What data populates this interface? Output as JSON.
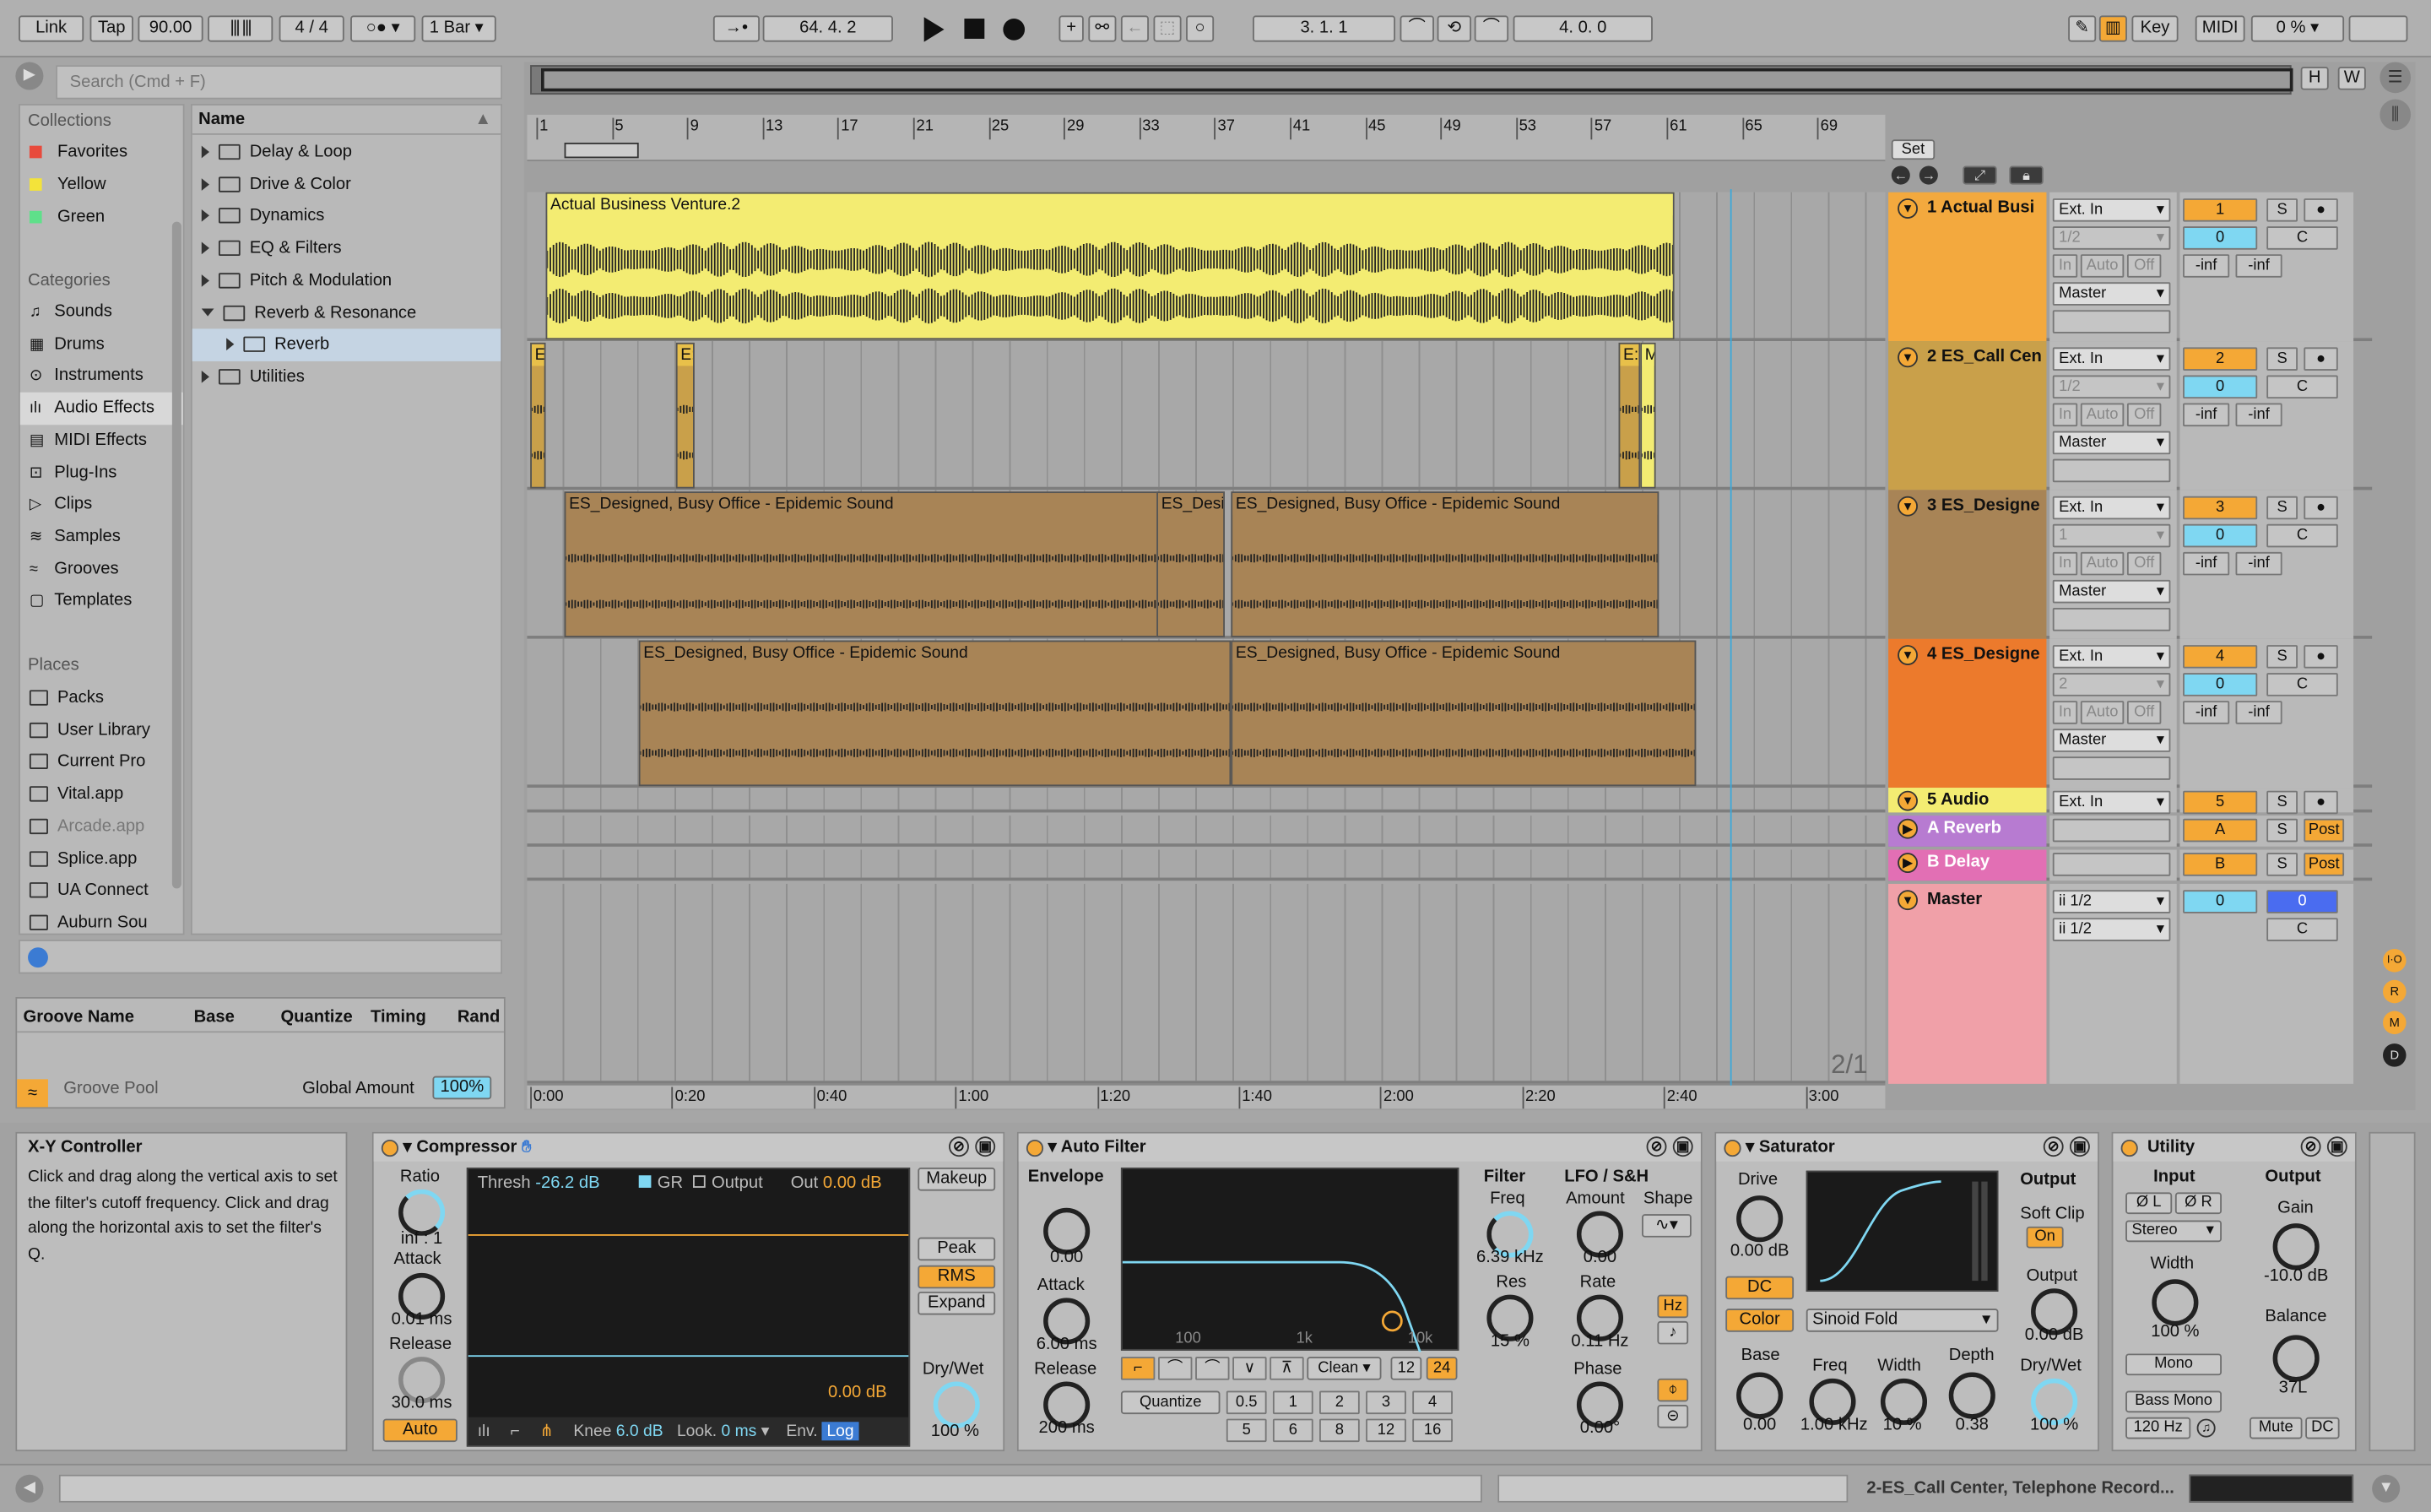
{
  "transport": {
    "link": "Link",
    "tap": "Tap",
    "tempo": "90.00",
    "meter": "4 / 4",
    "quant": "1 Bar",
    "position": "64.   4.   2",
    "loop_start": "3.   1.   1",
    "loop_len": "4.   0.   0",
    "key": "Key",
    "midi": "MIDI",
    "cpu": "0 %"
  },
  "browser": {
    "search_placeholder": "Search (Cmd + F)",
    "collections_title": "Collections",
    "collections": [
      {
        "label": "Favorites",
        "color": "#e84a3c"
      },
      {
        "label": "Yellow",
        "color": "#f3e33a"
      },
      {
        "label": "Green",
        "color": "#5fe08a"
      }
    ],
    "categories_title": "Categories",
    "categories": [
      "Sounds",
      "Drums",
      "Instruments",
      "Audio Effects",
      "MIDI Effects",
      "Plug-Ins",
      "Clips",
      "Samples",
      "Grooves",
      "Templates"
    ],
    "places_title": "Places",
    "places": [
      "Packs",
      "User Library",
      "Current Pro",
      "Vital.app",
      "Arcade.app",
      "Splice.app",
      "UA Connect",
      "Auburn Sou"
    ],
    "name_header": "Name",
    "items": [
      "Delay & Loop",
      "Drive & Color",
      "Dynamics",
      "EQ & Filters",
      "Pitch & Modulation",
      "Reverb & Resonance",
      "Reverb",
      "Utilities"
    ]
  },
  "groove": {
    "headers": [
      "Groove Name",
      "Base",
      "Quantize",
      "Timing",
      "Rand"
    ],
    "pool": "Groove Pool",
    "global": "Global Amount",
    "amount": "100%"
  },
  "arrangement": {
    "bars": [
      "1",
      "5",
      "9",
      "13",
      "17",
      "21",
      "25",
      "29",
      "33",
      "37",
      "41",
      "45",
      "49",
      "53",
      "57",
      "61",
      "65",
      "69"
    ],
    "times": [
      "0:00",
      "0:20",
      "0:40",
      "1:00",
      "1:20",
      "1:40",
      "2:00",
      "2:20",
      "2:40",
      "3:00"
    ],
    "ratio": "2/1",
    "set": "Set",
    "h": "H",
    "w": "W",
    "clips": {
      "c1": "Actual Business Venture.2",
      "c2a": "E",
      "c2b": "E:",
      "c2c": "E:",
      "c2d": "M",
      "c3a": "ES_Designed, Busy Office - Epidemic Sound",
      "c3b": "ES_Desi",
      "c3c": "ES_Designed, Busy Office - Epidemic Sound",
      "c4a": "ES_Designed, Busy Office - Epidemic Sound",
      "c4b": "ES_Designed, Busy Office - Epidemic Sound"
    }
  },
  "tracks": [
    {
      "name": "1 Actual Busi",
      "color": "#f3a93e",
      "in": "Ext. In",
      "ch": "1/2",
      "num": "1",
      "out": "Master",
      "vol": "0",
      "pan": "C",
      "ml": "-inf",
      "mr": "-inf"
    },
    {
      "name": "2 ES_Call Cen",
      "color": "#c9a04a",
      "in": "Ext. In",
      "ch": "1/2",
      "num": "2",
      "out": "Master",
      "vol": "0",
      "pan": "C",
      "ml": "-inf",
      "mr": "-inf"
    },
    {
      "name": "3 ES_Designe",
      "color": "#a88456",
      "in": "Ext. In",
      "ch": "1",
      "num": "3",
      "out": "Master",
      "vol": "0",
      "pan": "C",
      "ml": "-inf",
      "mr": "-inf"
    },
    {
      "name": "4 ES_Designe",
      "color": "#ec7a2c",
      "in": "Ext. In",
      "ch": "2",
      "num": "4",
      "out": "Master",
      "vol": "0",
      "pan": "C",
      "ml": "-inf",
      "mr": "-inf"
    }
  ],
  "returns": {
    "audio5": "5 Audio",
    "audio5_in": "Ext. In",
    "audio5_num": "5",
    "ra": "A Reverb",
    "rb": "B Delay",
    "ra_letter": "A",
    "rb_letter": "B",
    "post": "Post",
    "master": "Master",
    "master_in": "ii 1/2",
    "master_out": "ii 1/2",
    "master_vol": "0",
    "master_pan": "C",
    "master_cue": "0"
  },
  "mixer_labels": {
    "in": "In",
    "auto": "Auto",
    "off": "Off",
    "s": "S"
  },
  "info": {
    "title": "X-Y Controller",
    "text": "Click and drag along the vertical axis to set the filter's cutoff frequency. Click and drag along the horizontal axis to set the filter's Q."
  },
  "compressor": {
    "title": "Compressor",
    "ratio_l": "Ratio",
    "ratio": "inf : 1",
    "attack_l": "Attack",
    "attack": "0.01 ms",
    "release_l": "Release",
    "release": "30.0 ms",
    "auto": "Auto",
    "thresh_l": "Thresh",
    "thresh": "-26.2 dB",
    "gr": "GR",
    "output": "Output",
    "out_l": "Out",
    "out": "0.00 dB",
    "makeup": "Makeup",
    "peak": "Peak",
    "rms": "RMS",
    "expand": "Expand",
    "gain_db": "0.00 dB",
    "drywet_l": "Dry/Wet",
    "drywet": "100 %",
    "knee_l": "Knee",
    "knee": "6.0 dB",
    "look_l": "Look.",
    "look": "0 ms",
    "env_l": "Env.",
    "env": "Log"
  },
  "autofilter": {
    "title": "Auto Filter",
    "envelope_l": "Envelope",
    "envelope": "0.00",
    "attack_l": "Attack",
    "attack": "6.00 ms",
    "release_l": "Release",
    "release": "200 ms",
    "f100": "100",
    "f1k": "1k",
    "f10k": "10k",
    "filter_l": "Filter",
    "freq_l": "Freq",
    "freq": "6.39 kHz",
    "res_l": "Res",
    "res": "15 %",
    "lfo_l": "LFO / S&H",
    "amount_l": "Amount",
    "amount": "0.00",
    "shape_l": "Shape",
    "rate_l": "Rate",
    "rate": "0.11 Hz",
    "phase_l": "Phase",
    "phase": "0.00°",
    "hz": "Hz",
    "clean": "Clean",
    "s12": "12",
    "s24": "24",
    "quantize": "Quantize",
    "q": [
      "0.5",
      "1",
      "2",
      "3",
      "4",
      "5",
      "6",
      "8",
      "12",
      "16"
    ]
  },
  "saturator": {
    "title": "Saturator",
    "drive_l": "Drive",
    "drive": "0.00 dB",
    "dc": "DC",
    "color": "Color",
    "mode": "Sinoid Fold",
    "output_l": "Output",
    "softclip": "Soft Clip",
    "on": "On",
    "out_l": "Output",
    "out": "0.00 dB",
    "base_l": "Base",
    "base": "0.00",
    "freq_l": "Freq",
    "freq": "1.00 kHz",
    "width_l": "Width",
    "width": "10 %",
    "depth_l": "Depth",
    "depth": "0.38",
    "drywet_l": "Dry/Wet",
    "drywet": "100 %"
  },
  "utility": {
    "title": "Utility",
    "input_l": "Input",
    "output_l": "Output",
    "phl": "Ø L",
    "phr": "Ø R",
    "stereo": "Stereo",
    "width_l": "Width",
    "width": "100 %",
    "mono": "Mono",
    "bassmono": "Bass Mono",
    "hz": "120 Hz",
    "gain_l": "Gain",
    "gain": "-10.0 dB",
    "balance_l": "Balance",
    "balance": "37L",
    "mute": "Mute",
    "dc": "DC"
  },
  "status": {
    "clip": "2-ES_Call Center, Telephone Record..."
  }
}
